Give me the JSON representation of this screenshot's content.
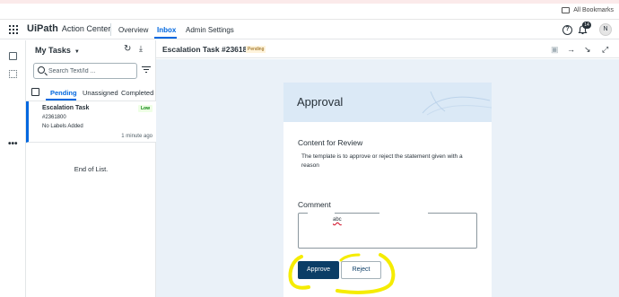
{
  "browser": {
    "bookmarks_label": "All Bookmarks"
  },
  "header": {
    "logo_ui": "Ui",
    "logo_path": "Path",
    "app_name": "Action Center",
    "tabs": [
      {
        "label": "Overview",
        "active": false
      },
      {
        "label": "Inbox",
        "active": true
      },
      {
        "label": "Admin Settings",
        "active": false
      }
    ],
    "help_glyph": "?",
    "notification_count": "14",
    "avatar_initial": "N"
  },
  "rail": {
    "icons": [
      "tasks-icon",
      "processes-icon"
    ],
    "more_glyph": "•••"
  },
  "task_list": {
    "title": "My Tasks",
    "search_placeholder": "Search Text/Id ...",
    "tabs": [
      {
        "label": "Pending",
        "active": true
      },
      {
        "label": "Unassigned",
        "active": false
      },
      {
        "label": "Completed",
        "active": false
      }
    ],
    "tasks": [
      {
        "title": "Escalation Task",
        "id": "#2361800",
        "labels": "No Labels Added",
        "priority": "Low",
        "time": "1 minute ago"
      }
    ],
    "end_text": "End of List."
  },
  "task_header": {
    "title": "Escalation Task #2361800",
    "status": "Pending"
  },
  "form": {
    "heading": "Approval",
    "section_title": "Content for Review",
    "section_body": "The template is to approve or reject the statement given with a reason",
    "comment_label": "Comment",
    "comment_value": "abc",
    "approve_label": "Approve",
    "reject_label": "Reject"
  },
  "colors": {
    "accent": "#0067df",
    "approve_bg": "#0b3d66",
    "annotation": "#f5ec00",
    "main_bg": "#eaf1f8"
  }
}
